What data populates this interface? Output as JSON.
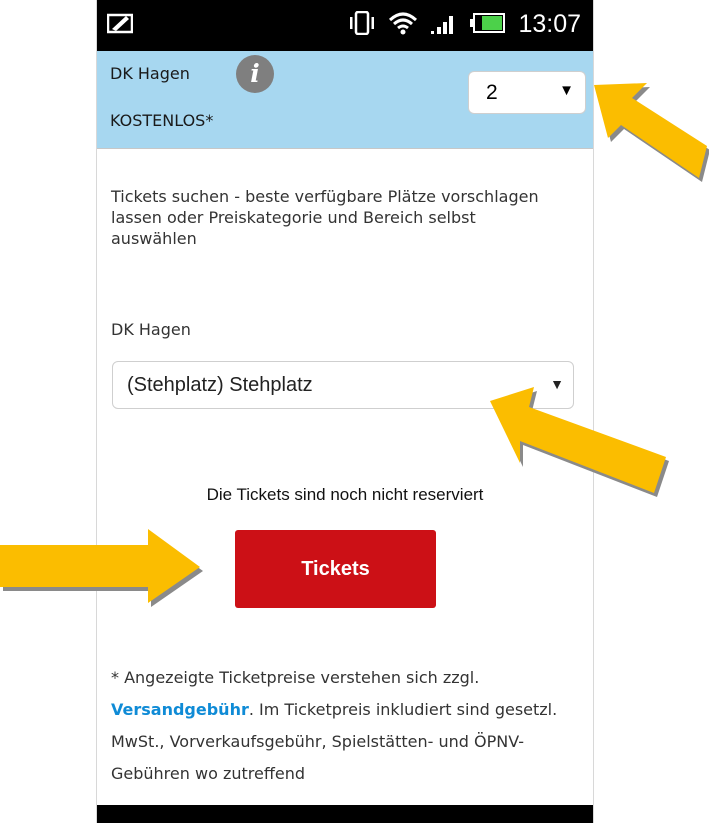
{
  "status_bar": {
    "time": "13:07"
  },
  "header": {
    "venue": "DK Hagen",
    "price_label": "KOSTENLOS*",
    "quantity": "2",
    "info_icon": "info-icon"
  },
  "main": {
    "description": "Tickets suchen - beste verfügbare Plätze vorschlagen lassen oder Preiskategorie und Bereich selbst auswählen",
    "venue_label": "DK Hagen",
    "area_select": "(Stehplatz) Stehplatz",
    "notice": "Die Tickets sind noch nicht reserviert",
    "tickets_button": "Tickets"
  },
  "footnote": {
    "prefix": "* Angezeigte Ticketpreise verstehen sich zzgl.",
    "link": "Versandgebühr",
    "suffix": ". Im Ticketpreis inkludiert sind gesetzl. MwSt., Vorverkaufsgebühr, Spielstätten- und ÖPNV-Gebühren wo zutreffend"
  },
  "colors": {
    "header_bg": "#a7d7f0",
    "button_red": "#cc1016",
    "link_blue": "#0f8bd6",
    "arrow_yellow": "#fbbd00"
  }
}
